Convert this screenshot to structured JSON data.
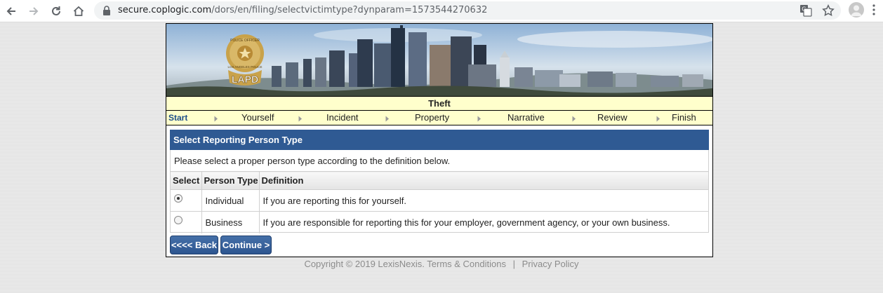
{
  "browser": {
    "url_host": "secure.coplogic.com",
    "url_path": "/dors/en/filing/selectvictimtype?dynparam=1573544270632"
  },
  "banner": {
    "badge_text": "LAPD",
    "badge_top": "POLICE OFFICER",
    "badge_bottom": "LOS ANGELES POLICE"
  },
  "form_title": "Theft",
  "steps": [
    "Start",
    "Yourself",
    "Incident",
    "Property",
    "Narrative",
    "Review",
    "Finish"
  ],
  "current_step": "Start",
  "panel": {
    "header": "Select Reporting Person Type",
    "instructions": "Please select a proper person type according to the definition below.",
    "columns": [
      "Select",
      "Person Type",
      "Definition"
    ],
    "rows": [
      {
        "selected": true,
        "type": "Individual",
        "definition": "If you are reporting this for yourself."
      },
      {
        "selected": false,
        "type": "Business",
        "definition": "If you are responsible for reporting this for your employer, government agency, or your own business."
      }
    ]
  },
  "buttons": {
    "back": "<<<< Back",
    "continue": "Continue >"
  },
  "footer": {
    "copyright": "Copyright ©  2019 LexisNexis.",
    "terms": "Terms & Conditions",
    "separator": "|",
    "privacy": "Privacy Policy"
  },
  "colors": {
    "accent": "#2f5a93",
    "step_bar": "#ffffcc",
    "current_step": "#1f4f8a"
  }
}
